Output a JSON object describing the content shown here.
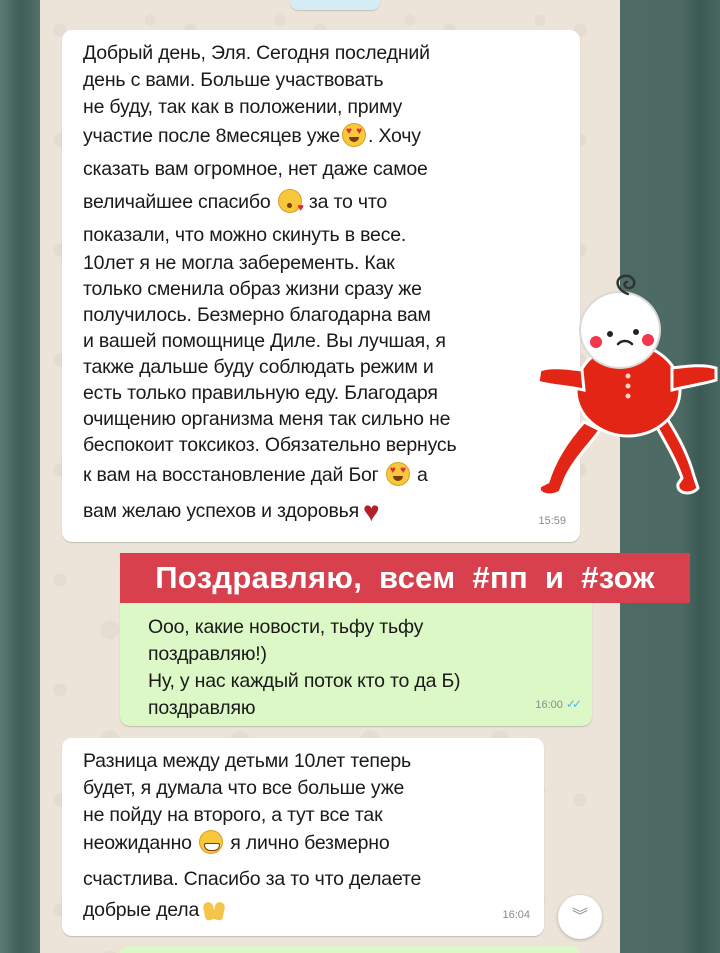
{
  "messages": [
    {
      "side": "incoming",
      "lines": [
        "Добрый день, Эля. Сегодня последний",
        "день с вами. Больше участвовать",
        "не буду, так как в положении, приму",
        "участие после 8месяцев уже",
        ". Хочу",
        "сказать вам огромное, нет даже самое",
        "величайшее спасибо",
        "за то что",
        "показали, что можно скинуть в весе.",
        "10лет я не могла заберементь. Как",
        "только сменила образ жизни сразу же",
        "получилось. Безмерно благодарна вам",
        "и вашей помощнице Диле. Вы лучшая, я",
        "также дальше буду соблюдать режим и",
        "есть только правильную еду. Благодаря",
        "очищению организма меня так сильно не",
        "беспокоит токсикоз. Обязательно вернусь",
        "к вам на восстановление дай Бог",
        "а",
        "вам желаю успехов и здоровья"
      ],
      "time": "15:59"
    },
    {
      "side": "outgoing",
      "lines": [
        "Ооо, какие новости, тьфу тьфу",
        "поздравляю!)",
        "Ну, у нас каждый поток кто то да Б)",
        "поздравляю"
      ],
      "time": "16:00",
      "read_ticks": "✓✓"
    },
    {
      "side": "incoming",
      "lines": [
        "Разница между детьми 10лет теперь",
        "будет, я думала что все больше уже",
        "не пойду на второго, а тут все так",
        "неожиданно",
        "я лично безмерно",
        "счастлива. Спасибо за то что делаете",
        "добрые дела"
      ],
      "time": "16:04"
    }
  ],
  "overlay_banner": "Поздравляю, всем #пп и #зож",
  "scroll_down_icon": "chevron-double-down-icon",
  "colors": {
    "incoming_bubble": "#ffffff",
    "outgoing_bubble": "#dcf8c6",
    "chat_background": "#ece4d9",
    "banner": "#d8404e",
    "read_ticks": "#4fb6ec"
  }
}
